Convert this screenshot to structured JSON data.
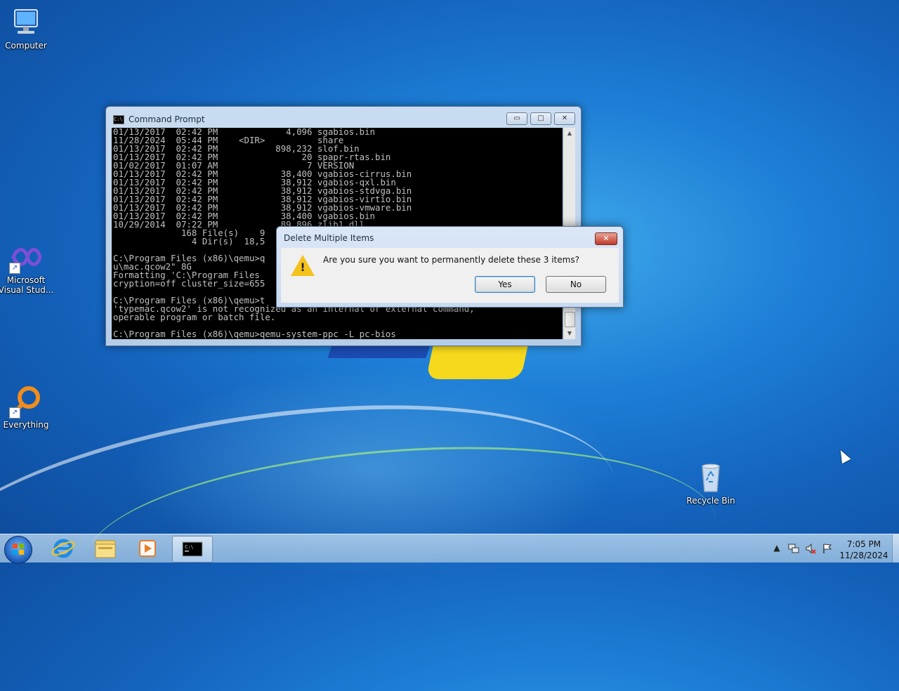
{
  "desktop": {
    "icons": [
      {
        "label": "Computer"
      },
      {
        "label": "Microsoft Visual Stud..."
      },
      {
        "label": "Everything"
      },
      {
        "label": "Recycle Bin"
      }
    ]
  },
  "cmd_window": {
    "title": "Command Prompt",
    "controls": {
      "minimize": "▭",
      "maximize": "□",
      "close": "✕"
    },
    "lines": [
      "01/13/2017  02:42 PM             4,096 sgabios.bin",
      "11/28/2024  05:44 PM    <DIR>          share",
      "01/13/2017  02:42 PM           898,232 slof.bin",
      "01/13/2017  02:42 PM                20 spapr-rtas.bin",
      "01/02/2017  01:07 AM                 7 VERSION",
      "01/13/2017  02:42 PM            38,400 vgabios-cirrus.bin",
      "01/13/2017  02:42 PM            38,912 vgabios-qxl.bin",
      "01/13/2017  02:42 PM            38,912 vgabios-stdvga.bin",
      "01/13/2017  02:42 PM            38,912 vgabios-virtio.bin",
      "01/13/2017  02:42 PM            38,912 vgabios-vmware.bin",
      "01/13/2017  02:42 PM            38,400 vgabios.bin",
      "10/29/2014  07:22 PM            89,896 zlib1.dll",
      "             168 File(s)    9",
      "               4 Dir(s)  18,5",
      "",
      "C:\\Program Files (x86)\\qemu>q",
      "u\\mac.qcow2\" 8G",
      "Formatting 'C:\\Program Files",
      "cryption=off cluster_size=655",
      "",
      "C:\\Program Files (x86)\\qemu>t",
      "'typemac.qcow2' is not recognized as an internal or external command,",
      "operable program or batch file.",
      "",
      "C:\\Program Files (x86)\\qemu>qemu-system-ppc -L pc-bios"
    ]
  },
  "dialog": {
    "title": "Delete Multiple Items",
    "close": "✕",
    "message": "Are you sure you want to permanently delete these 3 items?",
    "yes_label": "Yes",
    "no_label": "No"
  },
  "taskbar": {
    "time": "7:05 PM",
    "date": "11/28/2024",
    "pinned": [
      "internet-explorer",
      "file-explorer",
      "media-player",
      "command-prompt"
    ],
    "active": "command-prompt"
  },
  "colors": {
    "desktop_blue": "#1e7fd6",
    "console_bg": "#000000",
    "console_text": "#c0c0c0",
    "warning_yellow": "#f4c21b"
  }
}
